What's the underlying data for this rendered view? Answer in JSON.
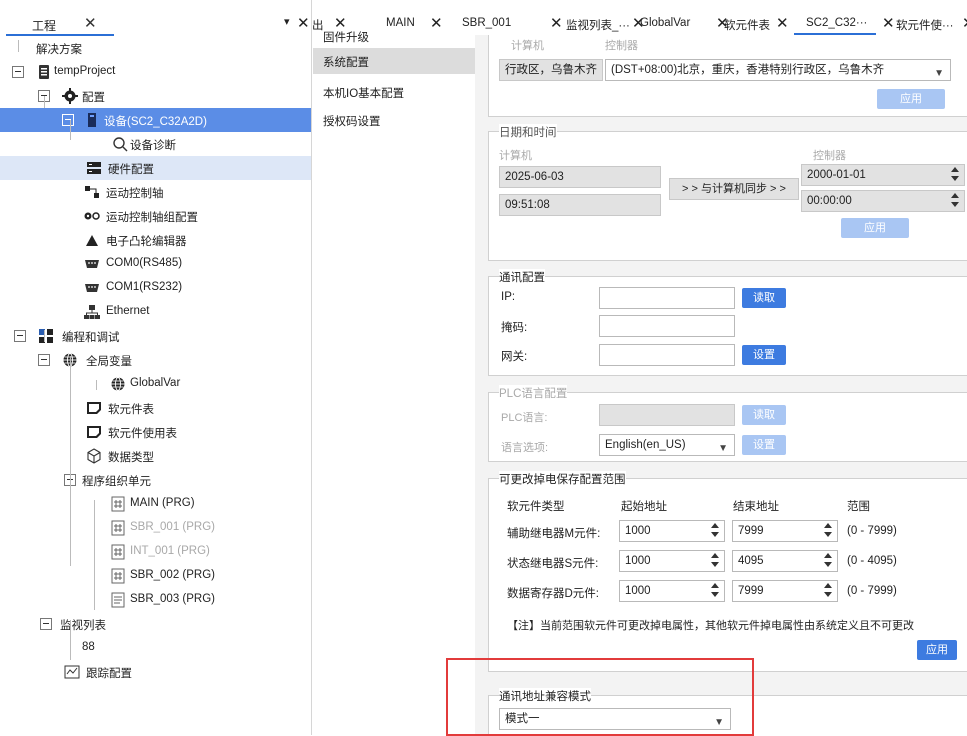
{
  "left_panel": {
    "title": "工程",
    "tab_close": "✕",
    "dropdown": "▾",
    "close": "✕",
    "tree": [
      {
        "label": "解决方案",
        "icon": "none"
      },
      {
        "label": "tempProject",
        "icon": "project-icon"
      },
      {
        "label": "配置",
        "icon": "gear-icon"
      },
      {
        "label": "设备(SC2_C32A2D)",
        "icon": "device-icon"
      },
      {
        "label": "设备诊断",
        "icon": "magnifier-icon"
      },
      {
        "label": "硬件配置",
        "icon": "hardware-icon"
      },
      {
        "label": "运动控制轴",
        "icon": "axis-icon"
      },
      {
        "label": "运动控制轴组配置",
        "icon": "axis-group-icon"
      },
      {
        "label": "电子凸轮编辑器",
        "icon": "cam-icon"
      },
      {
        "label": "COM0(RS485)",
        "icon": "com-port-icon"
      },
      {
        "label": "COM1(RS232)",
        "icon": "com-port-icon"
      },
      {
        "label": "Ethernet",
        "icon": "network-icon"
      },
      {
        "label": "编程和调试",
        "icon": "program-debug-icon"
      },
      {
        "label": "全局变量",
        "icon": "globe-icon"
      },
      {
        "label": "GlobalVar",
        "icon": "globe-icon"
      },
      {
        "label": "软元件表",
        "icon": "table-icon"
      },
      {
        "label": "软元件使用表",
        "icon": "table-icon"
      },
      {
        "label": "数据类型",
        "icon": "cube-icon"
      },
      {
        "label": "程序组织单元",
        "icon": "none"
      },
      {
        "label": "MAIN (PRG)",
        "icon": "ld-program-icon"
      },
      {
        "label": "SBR_001 (PRG)",
        "icon": "ld-program-icon"
      },
      {
        "label": "INT_001 (PRG)",
        "icon": "ld-program-icon"
      },
      {
        "label": "SBR_002 (PRG)",
        "icon": "ld-program-icon"
      },
      {
        "label": "SBR_003 (PRG)",
        "icon": "st-program-icon"
      },
      {
        "label": "监视列表",
        "icon": "none"
      },
      {
        "label": "88",
        "icon": "none"
      },
      {
        "label": "跟踪配置",
        "icon": "trace-icon"
      }
    ]
  },
  "tabs": [
    {
      "label": "出",
      "close": ""
    },
    {
      "label": "",
      "close": "✕"
    },
    {
      "label": "MAIN",
      "close": "✕"
    },
    {
      "label": "SBR_001",
      "close": "✕"
    },
    {
      "label": "监视列表_···",
      "close": "✕"
    },
    {
      "label": "GlobalVar",
      "close": "✕"
    },
    {
      "label": "软元件表",
      "close": "✕"
    },
    {
      "label": "SC2_C32···",
      "close": "✕"
    },
    {
      "label": "软元件使···",
      "close": "✕"
    }
  ],
  "settings_nav": {
    "items": [
      "固件升级",
      "系统配置",
      "本机IO基本配置",
      "授权码设置"
    ],
    "active_index": 1
  },
  "timezone": {
    "computer_label": "计算机",
    "controller_label": "控制器",
    "computer_value": "行政区，乌鲁木齐",
    "controller_value": "(DST+08:00)北京，重庆，香港特别行政区，乌鲁木齐",
    "apply": "应用"
  },
  "datetime": {
    "title": "日期和时间",
    "computer_label": "计算机",
    "controller_label": "控制器",
    "pc_date": "2025-06-03",
    "pc_time": "09:51:08",
    "sync_button": "> > 与计算机同步 > >",
    "ctrl_date": "2000-01-01",
    "ctrl_time": "00:00:00",
    "apply": "应用"
  },
  "comm": {
    "title": "通讯配置",
    "ip_label": "IP:",
    "mask_label": "掩码:",
    "gateway_label": "网关:",
    "ip": "",
    "mask": "",
    "gateway": "",
    "read": "读取",
    "set": "设置"
  },
  "plc_lang": {
    "title": "PLC语言配置",
    "lang_label": "PLC语言:",
    "option_label": "语言选项:",
    "lang_value": "",
    "option_value": "English(en_US)",
    "read": "读取",
    "set": "设置"
  },
  "retain": {
    "title": "可更改掉电保存配置范围",
    "headers": [
      "软元件类型",
      "起始地址",
      "结束地址",
      "范围"
    ],
    "rows": [
      {
        "type": "辅助继电器M元件:",
        "start": "1000",
        "end": "7999",
        "range": "(0 - 7999)"
      },
      {
        "type": "状态继电器S元件:",
        "start": "1000",
        "end": "4095",
        "range": "(0 - 4095)"
      },
      {
        "type": "数据寄存器D元件:",
        "start": "1000",
        "end": "7999",
        "range": "(0 - 7999)"
      }
    ],
    "note": "【注】当前范围软元件可更改掉电属性，其他软元件掉电属性由系统定义且不可更改",
    "apply": "应用"
  },
  "compat": {
    "title": "通讯地址兼容模式",
    "value": "模式一"
  },
  "colors": {
    "accent": "#3d7be0",
    "selected_row": "#5b8de6",
    "highlight_box": "#e23b3b"
  }
}
